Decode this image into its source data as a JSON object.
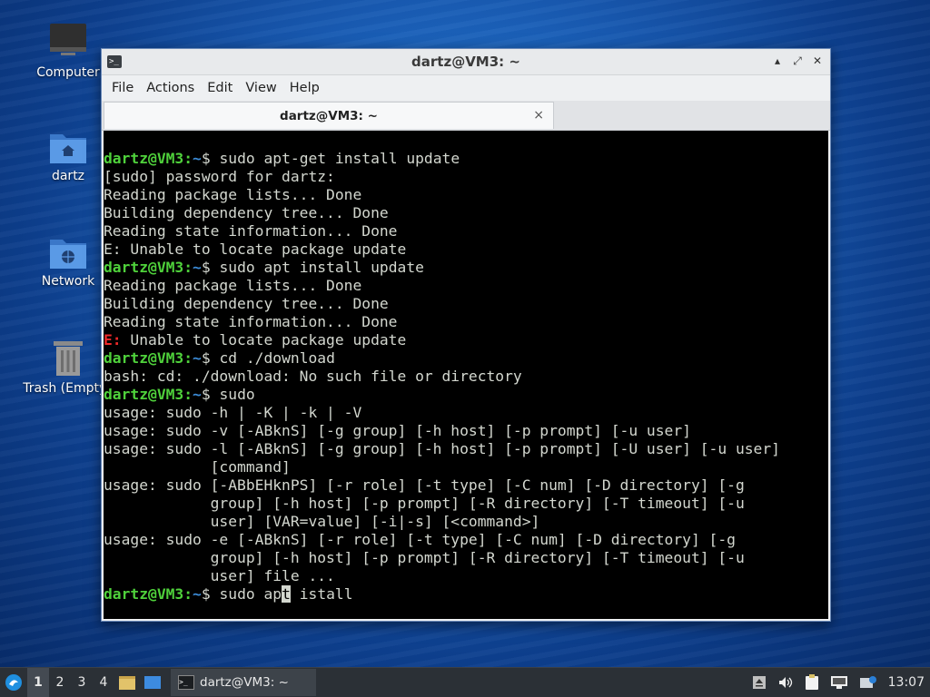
{
  "desktop": {
    "icons": [
      {
        "label": "Computer"
      },
      {
        "label": "dartz"
      },
      {
        "label": "Network"
      },
      {
        "label": "Trash (Empty)"
      }
    ]
  },
  "window": {
    "title": "dartz@VM3: ~",
    "menu": [
      "File",
      "Actions",
      "Edit",
      "View",
      "Help"
    ],
    "tab_label": "dartz@VM3: ~",
    "tab_close": "×",
    "controls": {
      "minimize": "▴",
      "maximize": "⤢",
      "close": "✕"
    }
  },
  "terminal": {
    "prompt_user": "dartz@VM3",
    "prompt_colon": ":",
    "prompt_path": "~",
    "prompt_symbol": "$ ",
    "lines": [
      {
        "cmd": "sudo apt-get install update"
      },
      {
        "text": "[sudo] password for dartz:"
      },
      {
        "text": "Reading package lists... Done"
      },
      {
        "text": "Building dependency tree... Done"
      },
      {
        "text": "Reading state information... Done"
      },
      {
        "text": "E: Unable to locate package update"
      },
      {
        "cmd": "sudo apt install update"
      },
      {
        "text": "Reading package lists... Done"
      },
      {
        "text": "Building dependency tree... Done"
      },
      {
        "text": "Reading state information... Done"
      },
      {
        "err": "E:",
        "text": " Unable to locate package update"
      },
      {
        "cmd": "cd ./download"
      },
      {
        "text": "bash: cd: ./download: No such file or directory"
      },
      {
        "cmd": "sudo"
      },
      {
        "text": "usage: sudo -h | -K | -k | -V"
      },
      {
        "text": "usage: sudo -v [-ABknS] [-g group] [-h host] [-p prompt] [-u user]"
      },
      {
        "text": "usage: sudo -l [-ABknS] [-g group] [-h host] [-p prompt] [-U user] [-u user]"
      },
      {
        "text": "            [command]"
      },
      {
        "text": "usage: sudo [-ABbEHknPS] [-r role] [-t type] [-C num] [-D directory] [-g"
      },
      {
        "text": "            group] [-h host] [-p prompt] [-R directory] [-T timeout] [-u"
      },
      {
        "text": "            user] [VAR=value] [-i|-s] [<command>]"
      },
      {
        "text": "usage: sudo -e [-ABknS] [-r role] [-t type] [-C num] [-D directory] [-g"
      },
      {
        "text": "            group] [-h host] [-p prompt] [-R directory] [-T timeout] [-u"
      },
      {
        "text": "            user] file ..."
      }
    ],
    "current_input": {
      "before": "sudo ap",
      "cursor": "t",
      "after": " istall"
    }
  },
  "taskbar": {
    "workspaces": [
      "1",
      "2",
      "3",
      "4"
    ],
    "active_workspace": "1",
    "task_label": "dartz@VM3: ~",
    "clock": "13:07"
  }
}
